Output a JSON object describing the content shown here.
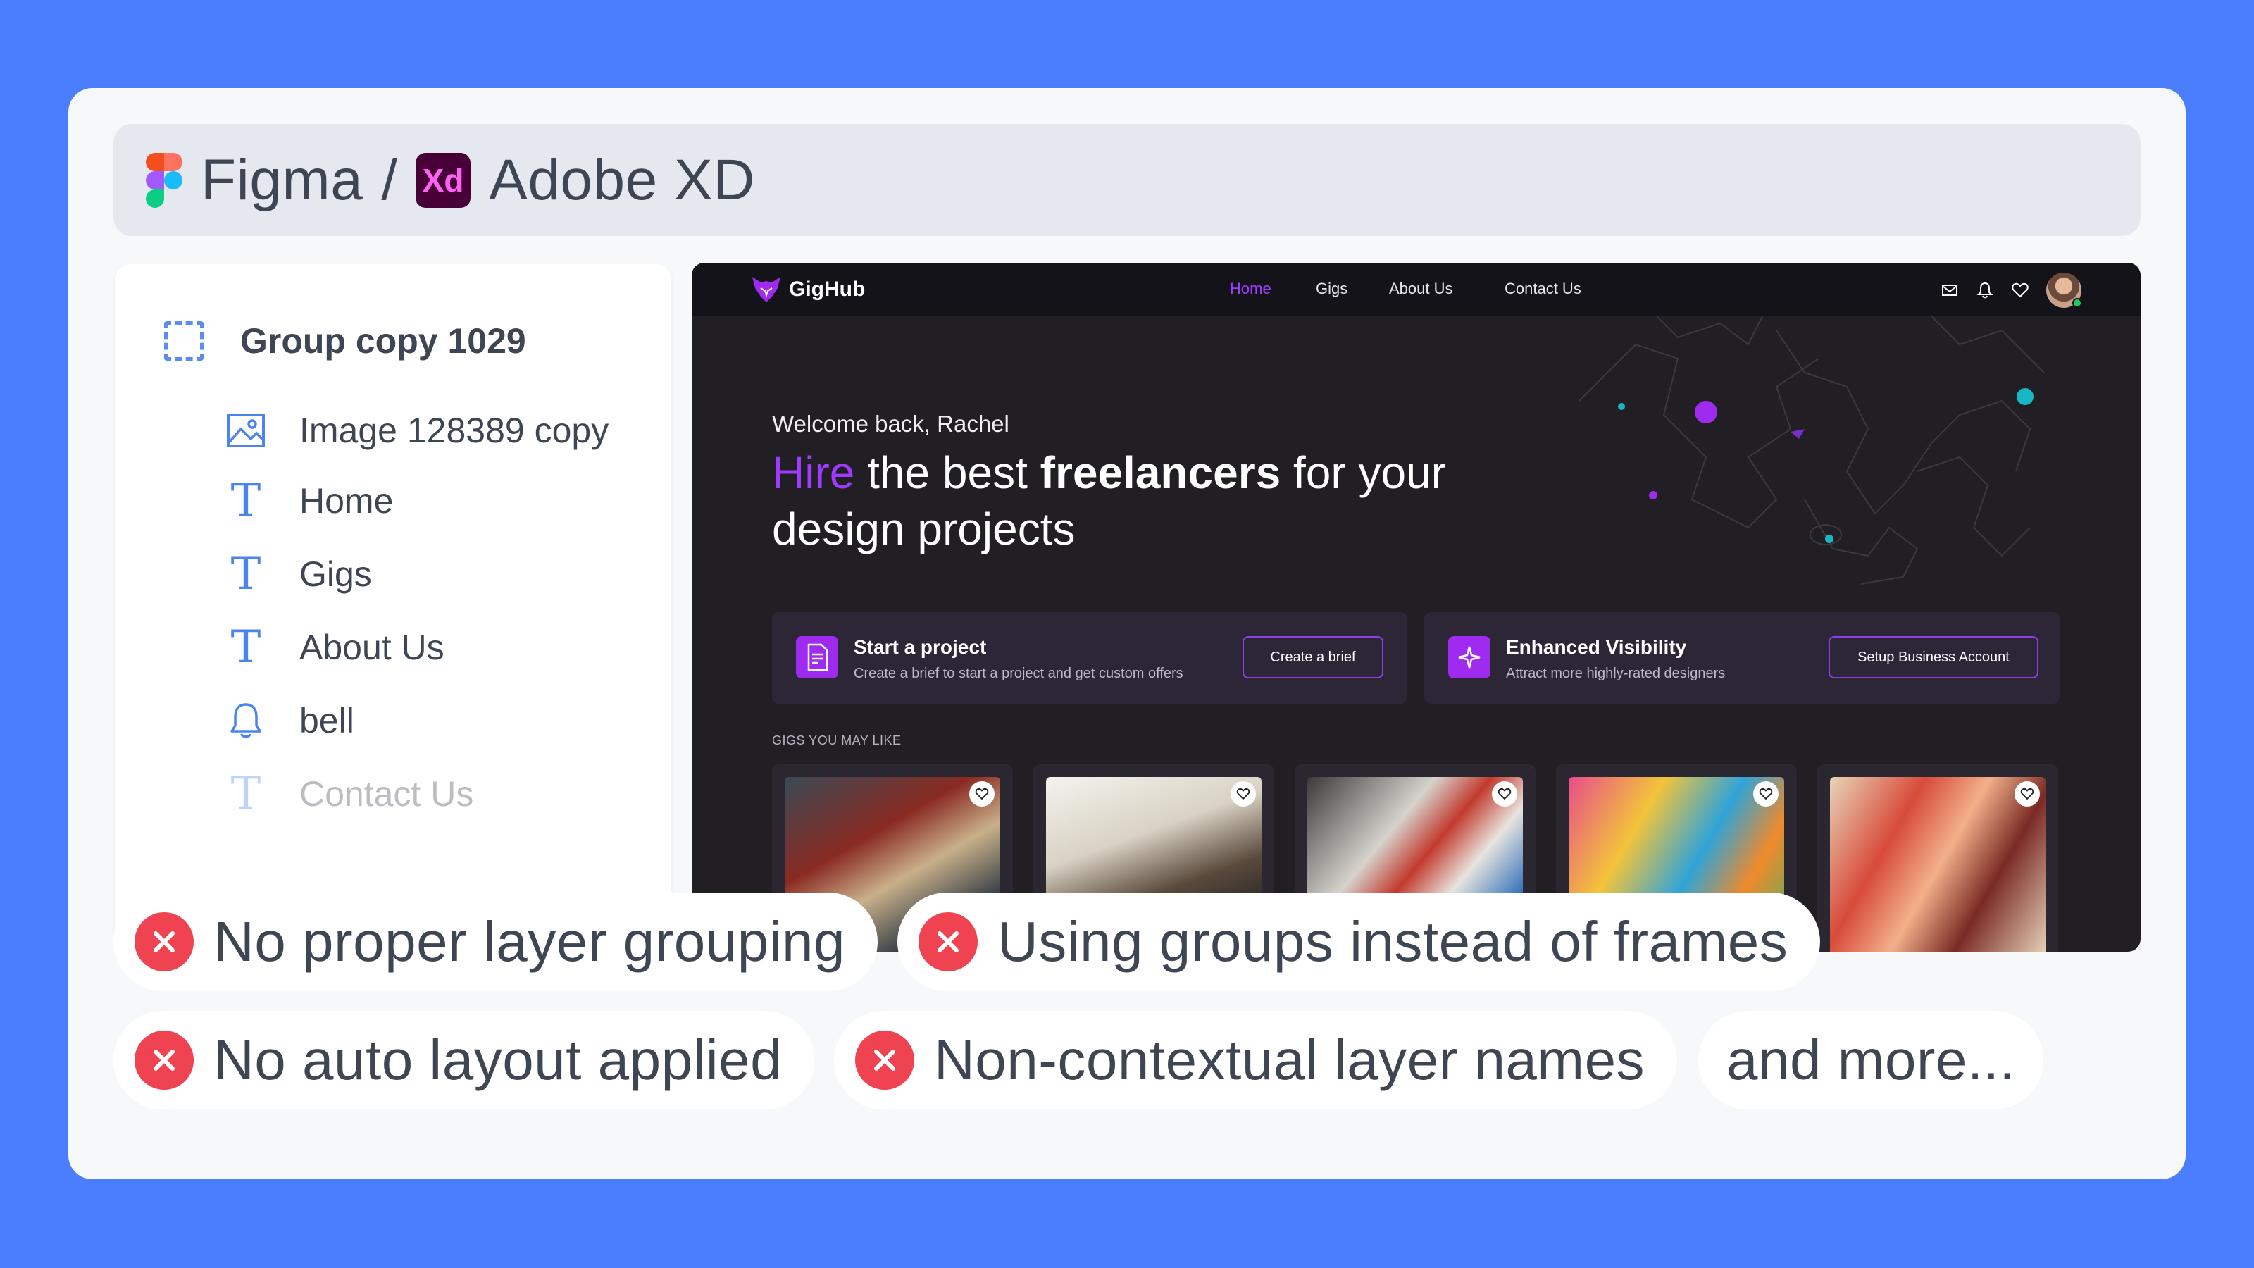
{
  "header": {
    "tool1": "Figma",
    "separator": "/",
    "xd_badge": "Xd",
    "tool2": "Adobe XD",
    "colors": {
      "xd_bg": "#470137",
      "xd_text": "#ff61f6"
    }
  },
  "layers_panel": {
    "group_title": "Group copy 1029",
    "items": [
      {
        "icon": "image-icon",
        "label": "Image 128389 copy"
      },
      {
        "icon": "text-icon",
        "label": "Home"
      },
      {
        "icon": "text-icon",
        "label": "Gigs"
      },
      {
        "icon": "text-icon",
        "label": "About Us"
      },
      {
        "icon": "bell-icon",
        "label": "bell"
      },
      {
        "icon": "text-icon",
        "label": "Contact Us"
      }
    ]
  },
  "preview": {
    "brand": "GigHub",
    "nav": [
      "Home",
      "Gigs",
      "About Us",
      "Contact Us"
    ],
    "nav_active": "Home",
    "nav_icons": [
      "mail-icon",
      "bell-icon",
      "heart-icon"
    ],
    "welcome": "Welcome back, Rachel",
    "headline": {
      "accent": "Hire",
      "part1": " the best ",
      "bold": "freelancers",
      "part2": " for your design projects"
    },
    "promos": [
      {
        "title": "Start a project",
        "subtitle": "Create a brief to start a project and get custom offers",
        "button": "Create a brief"
      },
      {
        "title": "Enhanced Visibility",
        "subtitle": "Attract more highly-rated designers",
        "button": "Setup Business Account"
      }
    ],
    "gigs_label": "GIGS YOU MAY LIKE",
    "colors": {
      "accent": "#9f3bff",
      "background": "#211e24",
      "nav": "#15131a"
    }
  },
  "issues": [
    "No proper layer grouping",
    "Using groups instead of frames",
    "No auto layout applied",
    "Non-contextual layer names"
  ],
  "more": "and more...",
  "colors": {
    "page_bg": "#4a7eff",
    "error": "#ef4351"
  }
}
